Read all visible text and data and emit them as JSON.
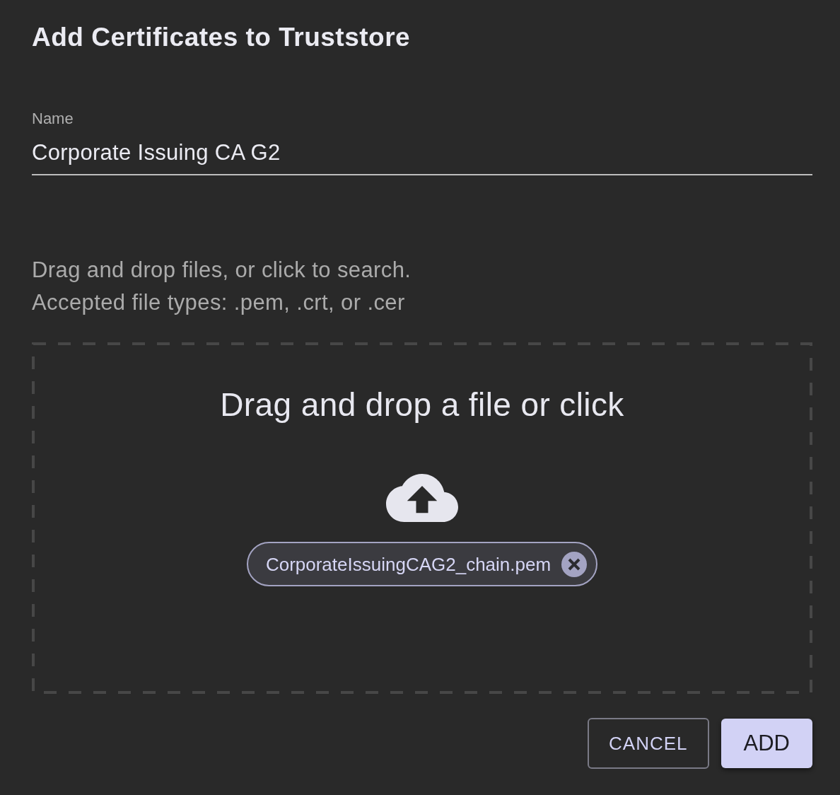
{
  "dialog": {
    "title": "Add Certificates to Truststore"
  },
  "name_field": {
    "label": "Name",
    "value": "Corporate Issuing CA G2"
  },
  "instructions": [
    "Drag and drop files, or click to search.",
    "Accepted file types: .pem, .crt, or .cer"
  ],
  "dropzone": {
    "prompt": "Drag and drop a file or click",
    "files": [
      {
        "name": "CorporateIssuingCAG2_chain.pem"
      }
    ]
  },
  "buttons": [
    {
      "label": "CANCEL",
      "kind": "outlined"
    },
    {
      "label": "ADD",
      "kind": "filled"
    }
  ]
}
